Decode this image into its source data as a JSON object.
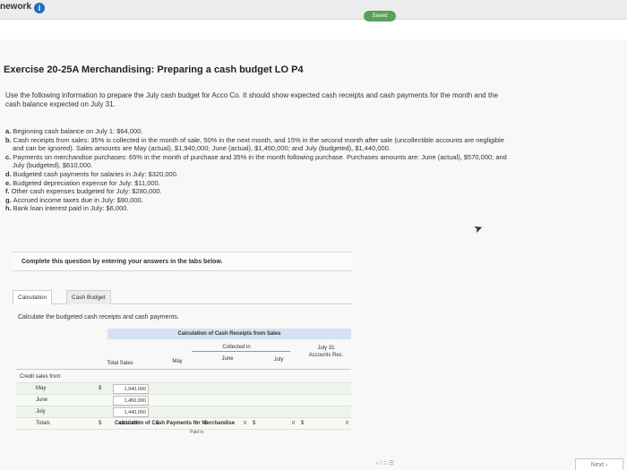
{
  "header": {
    "brand": "nework",
    "saved_label": "Saved"
  },
  "exercise": {
    "title": "Exercise 20-25A Merchandising: Preparing a cash budget LO P4",
    "intro": "Use the following information to prepare the July cash budget for Acco Co. It should show expected cash receipts and cash payments for the month and the cash balance expected on July 31.",
    "items": [
      {
        "key": "a.",
        "text": "Beginning cash balance on July 1: $64,000."
      },
      {
        "key": "b.",
        "text": "Cash receipts from sales: 35% is collected in the month of sale, 50% in the next month, and 15% in the second month after sale (uncollectible accounts are negligible and can be ignored). Sales amounts are May (actual), $1,940,000; June (actual), $1,450,000; and July (budgeted), $1,440,000."
      },
      {
        "key": "c.",
        "text": "Payments on merchandise purchases: 65% in the month of purchase and 35% in the month following purchase. Purchases amounts are: June (actual), $570,000; and July (budgeted), $610,000."
      },
      {
        "key": "d.",
        "text": "Budgeted cash payments for salaries in July: $320,000."
      },
      {
        "key": "e.",
        "text": "Budgeted depreciation expense for July: $11,000."
      },
      {
        "key": "f.",
        "text": "Other cash expenses budgeted for July: $280,000."
      },
      {
        "key": "g.",
        "text": "Accrued income taxes due in July: $90,000."
      },
      {
        "key": "h.",
        "text": "Bank loan interest paid in July: $6,000."
      }
    ]
  },
  "instructions": "Complete this question by entering your answers in the tabs below.",
  "tabs": [
    {
      "label": "Calculation"
    },
    {
      "label": "Cash Budget"
    }
  ],
  "calc_text": "Calculate the budgeted cash receipts and cash payments.",
  "receipts_table": {
    "title": "Calculation of Cash Receipts from Sales",
    "collected_in": "Collected in",
    "col_total": "Total Sales",
    "col_may": "May",
    "col_june": "June",
    "col_july": "July",
    "col_july31": "July 31",
    "col_accounts_rec": "Accounts Rec.",
    "row_group": "Credit sales from:",
    "rows": [
      {
        "label": "May",
        "dollar": "$",
        "total": "1,940,000"
      },
      {
        "label": "June",
        "dollar": "",
        "total": "1,450,000"
      },
      {
        "label": "July",
        "dollar": "",
        "total": "1,440,000"
      }
    ],
    "totals": {
      "label": "Totals",
      "dollar": "$",
      "total": "4,830,000",
      "may_dollar": "$",
      "may": "0",
      "june_dollar": "$",
      "june": "0",
      "july_dollar": "$",
      "july": "0",
      "jul31_dollar": "$",
      "jul31": "0"
    }
  },
  "payments_table": {
    "title": "Calculation of Cash Payments for Merchandise",
    "paid_in": "Paid in"
  },
  "footer": {
    "next_label": "Next"
  }
}
